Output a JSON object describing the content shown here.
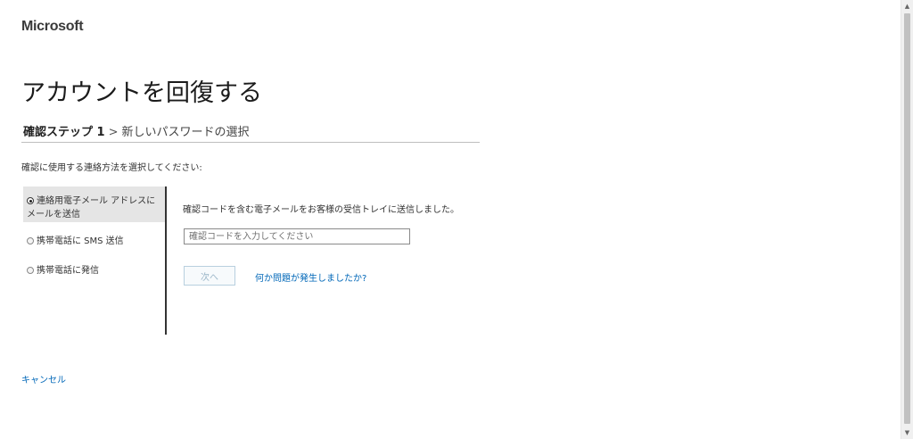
{
  "header": {
    "brand": "Microsoft"
  },
  "page": {
    "title": "アカウントを回復する"
  },
  "breadcrumb": {
    "current_step": "確認ステップ 1",
    "separator": ">",
    "next_step": "新しいパスワードの選択"
  },
  "instruction": "確認に使用する連絡方法を選択してください:",
  "methods": [
    {
      "label": "連絡用電子メール アドレスにメールを送信",
      "selected": true
    },
    {
      "label": "携帯電話に SMS 送信",
      "selected": false
    },
    {
      "label": "携帯電話に発信",
      "selected": false
    }
  ],
  "panel": {
    "message": "確認コードを含む電子メールをお客様の受信トレイに送信しました。",
    "code_input": {
      "value": "",
      "placeholder": "確認コードを入力してください"
    },
    "next_label": "次へ",
    "help_link": "何か問題が発生しましたか?"
  },
  "footer": {
    "cancel_label": "キャンセル"
  },
  "scrollbar": {
    "up_arrow_icon": "triangle-up-icon",
    "down_arrow_icon": "triangle-down-icon"
  }
}
